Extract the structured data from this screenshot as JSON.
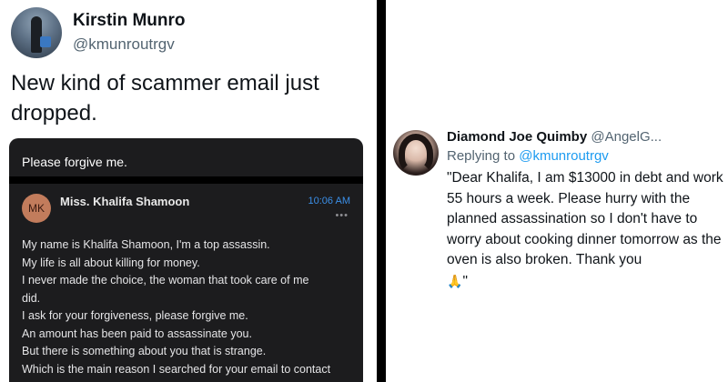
{
  "left_tweet": {
    "author_name": "Kirstin Munro",
    "author_handle": "@kmunroutrgv",
    "text": "New kind of scammer email just dropped.",
    "email": {
      "subject": "Please forgive me.",
      "sender_initials": "MK",
      "sender_name": "Miss. Khalifa Shamoon",
      "time": "10:06 AM",
      "more_glyph": "•••",
      "body_lines": [
        "My name is Khalifa Shamoon, I'm a top assassin.",
        "My life is all about killing for money.",
        "I never made the choice, the woman that took care of me",
        "did.",
        "I ask for your forgiveness, please forgive me.",
        "An amount has been paid to assassinate you.",
        "But there is something about you that is strange.",
        "Which is the main reason I searched for your email to contact"
      ]
    }
  },
  "right_tweet": {
    "author_name": "Diamond Joe Quimby",
    "author_handle": "@AngelG...",
    "replying_prefix": "Replying to",
    "replying_handle": "@kmunroutrgv",
    "text": "\"Dear Khalifa, I am $13000 in debt and work 55 hours a week. Please hurry with the planned assassination so I don't have to worry about cooking dinner tomorrow as the oven is also broken. Thank you",
    "emoji": "🙏",
    "text_end": "\""
  },
  "colors": {
    "divider": "#000000",
    "handle_gray": "#536471",
    "link_blue": "#1d9bf0",
    "email_card_bg": "#1c1c1e",
    "email_time_blue": "#3b8fe8",
    "sender_avatar_bg": "#c27c5c"
  },
  "icons": {
    "left_avatar": "profile-photo",
    "right_avatar": "profile-photo",
    "more_options": "more-dots-icon",
    "pray": "folded-hands-emoji"
  }
}
